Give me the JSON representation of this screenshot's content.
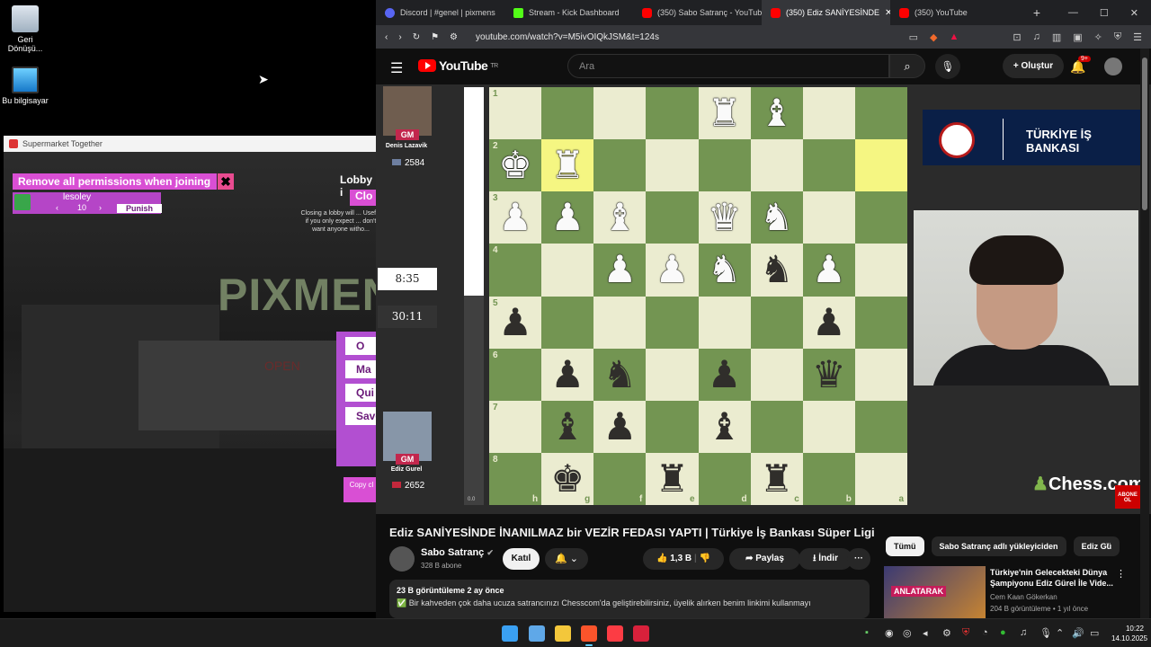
{
  "desktop": {
    "icons": [
      {
        "label": "Geri Dönüşü..."
      },
      {
        "label": "Bu bilgisayar"
      }
    ]
  },
  "game": {
    "window_title": "Supermarket Together",
    "permissions_banner": "Remove all permissions when joining",
    "close_symbol": "✖",
    "player_name": "lesoley",
    "player_value": "10",
    "step_prev": "‹",
    "step_next": "›",
    "punish_label": "Punish",
    "lobby_title": "Lobby i",
    "lobby_close_label": "Clo",
    "lobby_note": "Closing a lobby will ... Useful if you only expect ... don't want anyone witho...",
    "store_sign": "PIXMEN",
    "open_sign": "OPEN",
    "menu_items": [
      "O",
      "Ma",
      "Qui",
      "Save"
    ],
    "copy_label": "Copy cl"
  },
  "browser": {
    "tabs": [
      {
        "label": "Discord | #genel | pixmens",
        "color": "#5865f2"
      },
      {
        "label": "Stream - Kick Dashboard",
        "color": "#53fc18"
      },
      {
        "label": "(350) Sabo Satranç - YouTube",
        "color": "#ff0000"
      },
      {
        "label": "(350) Ediz SANİYESİNDE",
        "color": "#ff0000",
        "active": true
      },
      {
        "label": "(350) YouTube",
        "color": "#ff0000"
      }
    ],
    "tab_close": "✕",
    "new_tab": "+",
    "window_controls": [
      "—",
      "☐",
      "✕"
    ],
    "url": "youtube.com/watch?v=M5ivOIQkJSM&t=124s"
  },
  "youtube": {
    "logo_text": "YouTube",
    "logo_region": "TR",
    "search_placeholder": "Ara",
    "create_label": "+ Oluştur",
    "notifications_badge": "9+",
    "video": {
      "top_player": {
        "name": "Denis Lazavik",
        "title": "GM",
        "rating": "2584"
      },
      "bottom_player": {
        "name": "Ediz Gurel",
        "title": "GM",
        "rating": "2652"
      },
      "clock_top": "8:35",
      "clock_bottom": "30:11",
      "eval": "0.0",
      "sponsor": "TÜRKİYE İŞ BANKASI",
      "brand": "Chess.com",
      "abone": "ABONE OL",
      "board": {
        "ranks_labels": [
          "1",
          "2",
          "3",
          "4",
          "5",
          "6",
          "7",
          "8"
        ],
        "files_labels": [
          "h",
          "g",
          "f",
          "e",
          "d",
          "c",
          "b",
          "a"
        ],
        "rows": [
          [
            "",
            "",
            "",
            "",
            "wR",
            "wB",
            "",
            ""
          ],
          [
            "wK",
            "wR",
            "",
            "",
            "",
            "",
            "",
            ""
          ],
          [
            "wP",
            "wP",
            "wB",
            "",
            "wQ",
            "wN",
            "",
            ""
          ],
          [
            "",
            "",
            "wP",
            "wP",
            "wN",
            "bN",
            "wP",
            ""
          ],
          [
            "bP",
            "",
            "",
            "",
            "",
            "",
            "bP",
            ""
          ],
          [
            "",
            "bP",
            "bN",
            "",
            "bP",
            "",
            "bQ",
            ""
          ],
          [
            "",
            "bB",
            "bP",
            "",
            "bB",
            "",
            "",
            ""
          ],
          [
            "",
            "bK",
            "",
            "bR",
            "",
            "bR",
            "",
            ""
          ]
        ],
        "highlights": [
          "1-1",
          "1-7"
        ]
      }
    },
    "title": "Ediz SANİYESİNDE İNANILMAZ bir VEZİR FEDASI YAPTI | Türkiye İş Bankası Süper Ligi",
    "channel": {
      "name": "Sabo Satranç",
      "subscribers": "328 B abone"
    },
    "join_label": "Katıl",
    "bell_label": "🔔 ⌄",
    "likes": "1,3 B",
    "share_label": "Paylaş",
    "download_label": "İndir",
    "more_label": "···",
    "description": {
      "views": "23 B görüntüleme  2 ay önce",
      "text": "Bir kahveden çok daha ucuza satrancınızı Chesscom'da geliştirebilirsiniz, üyelik alırken benim linkimi kullanmayı"
    },
    "chips": [
      "Tümü",
      "Sabo Satranç adlı yükleyiciden",
      "Ediz Gü"
    ],
    "recommendation": {
      "title": "Türkiye'nin Gelecekteki Dünya Şampiyonu Ediz Gürel İle Vide...",
      "channel": "Cem Kaan Gökerkan",
      "meta": "204 B görüntüleme • 1 yıl önce",
      "thumb_label": "ANLATARAK"
    }
  },
  "taskbar": {
    "time": "10:22",
    "date": "14.10.2025"
  }
}
